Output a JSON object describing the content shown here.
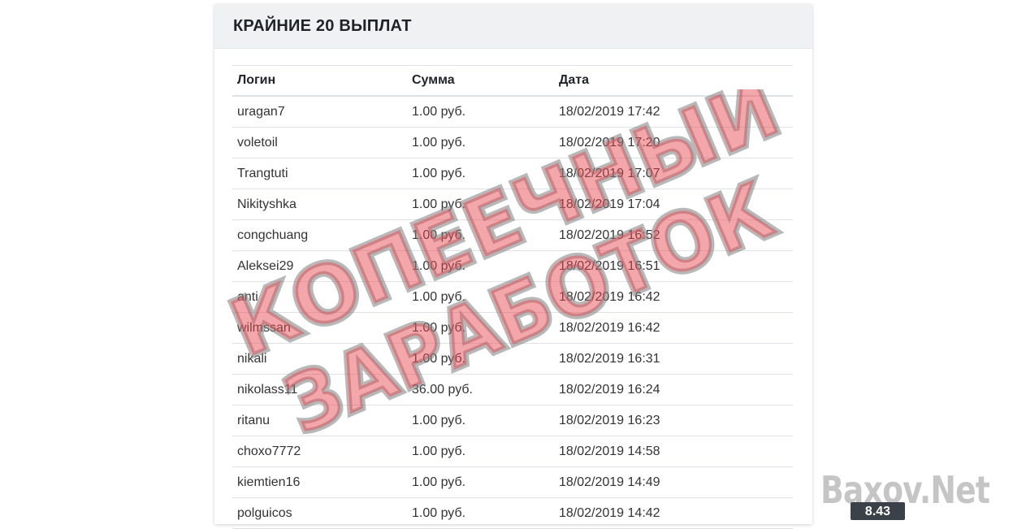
{
  "card": {
    "title": "КРАЙНИЕ 20 ВЫПЛАТ"
  },
  "table": {
    "headers": [
      "Логин",
      "Сумма",
      "Дата"
    ],
    "rows": [
      [
        "uragan7",
        "1.00 руб.",
        "18/02/2019 17:42"
      ],
      [
        "voletoil",
        "1.00 руб.",
        "18/02/2019 17:20"
      ],
      [
        "Trangtuti",
        "1.00 руб.",
        "18/02/2019 17:07"
      ],
      [
        "Nikityshka",
        "1.00 руб.",
        "18/02/2019 17:04"
      ],
      [
        "congchuang",
        "1.00 руб.",
        "18/02/2019 16:52"
      ],
      [
        "Aleksei29",
        "1.00 руб.",
        "18/02/2019 16:51"
      ],
      [
        "anti",
        "1.00 руб.",
        "18/02/2019 16:42"
      ],
      [
        "wilmssan",
        "1.00 руб.",
        "18/02/2019 16:42"
      ],
      [
        "nikali",
        "1.00 руб.",
        "18/02/2019 16:31"
      ],
      [
        "nikolass11",
        "36.00 руб.",
        "18/02/2019 16:24"
      ],
      [
        "ritanu",
        "1.00 руб.",
        "18/02/2019 16:23"
      ],
      [
        "choxo7772",
        "1.00 руб.",
        "18/02/2019 14:58"
      ],
      [
        "kiemtien16",
        "1.00 руб.",
        "18/02/2019 14:49"
      ],
      [
        "polguicos",
        "1.00 руб.",
        "18/02/2019 14:42"
      ]
    ]
  },
  "stamp": {
    "line1": "КОПЕЕЧНЫЙ",
    "line2": "ЗАРАБОТОК"
  },
  "watermark": {
    "site": "Baxov.Net",
    "badge": "8.43"
  },
  "colors": {
    "header_bg": "#f0f1f2",
    "stamp_fill": "#e84850",
    "border": "#dee2e6"
  }
}
